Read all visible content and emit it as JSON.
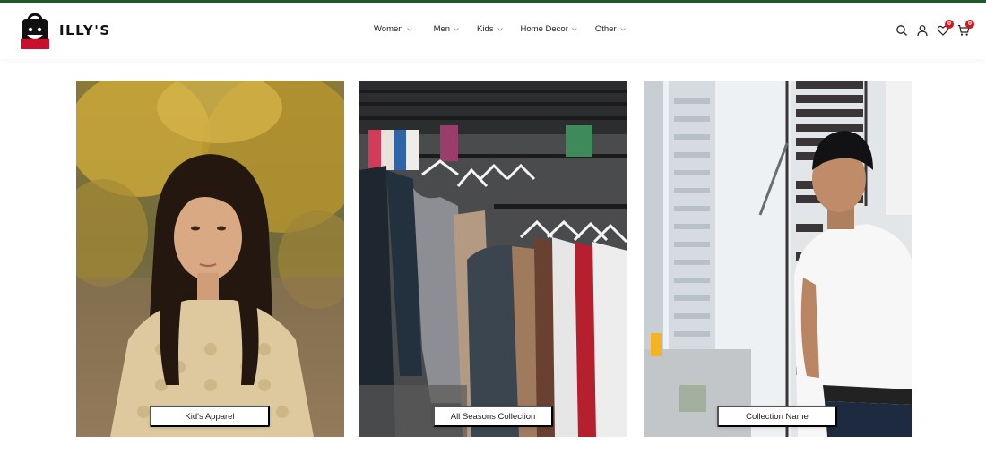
{
  "brand": {
    "name": "ILLY'S",
    "logo_icon": "shopping-bag-face-logo",
    "accent": "#c8102e"
  },
  "top_bar_color": "#1e5a2a",
  "nav": {
    "items": [
      {
        "label": "Women",
        "icon": "chevron-down-icon"
      },
      {
        "label": "Men",
        "icon": "chevron-down-icon"
      },
      {
        "label": "Kids",
        "icon": "chevron-down-icon"
      },
      {
        "label": "Home Decor",
        "icon": "chevron-down-icon"
      },
      {
        "label": "Other",
        "icon": "chevron-down-icon"
      }
    ]
  },
  "actions": {
    "search_icon": "search-icon",
    "account_icon": "user-icon",
    "wishlist": {
      "icon": "heart-icon",
      "count": "0"
    },
    "cart": {
      "icon": "cart-icon",
      "count": "0"
    },
    "badge_color": "#d4181f"
  },
  "collections": [
    {
      "label": "Kid's Apparel",
      "image": "girl-in-yellow-sweater"
    },
    {
      "label": "All Seasons Collection",
      "image": "clothes-on-rack"
    },
    {
      "label": "Collection Name",
      "image": "man-in-white-shirt-on-stairs"
    }
  ]
}
